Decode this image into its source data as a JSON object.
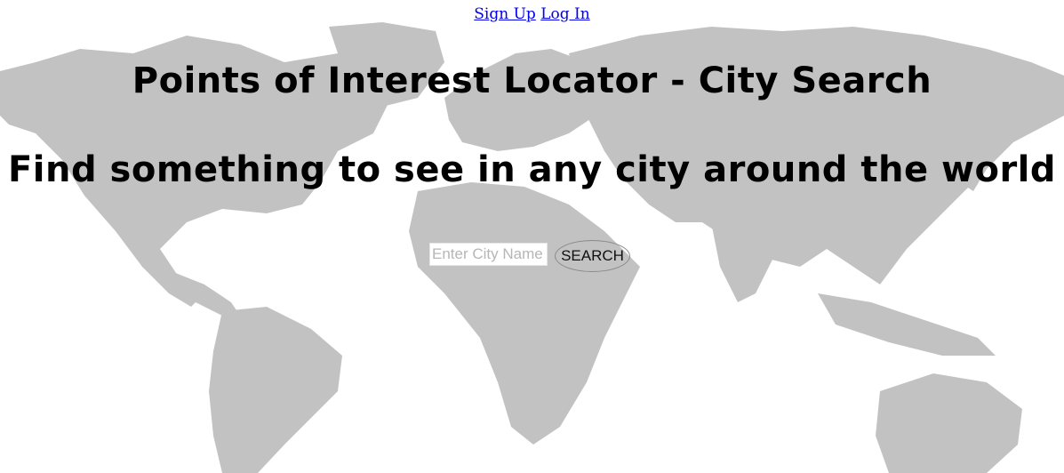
{
  "header": {
    "signup_label": "Sign Up",
    "login_label": "Log In"
  },
  "main": {
    "title": "Points of Interest Locator - City Search",
    "subtitle": "Find something to see in any city around the world"
  },
  "search": {
    "placeholder": "Enter City Name",
    "value": "",
    "button_label": "SEARCH"
  },
  "colors": {
    "link": "#0000ee",
    "map_land": "#bdbdbd",
    "background": "#ffffff"
  }
}
